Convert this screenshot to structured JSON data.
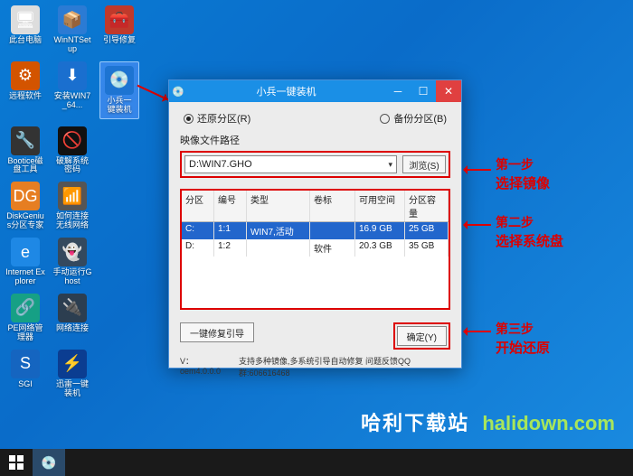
{
  "desktop": {
    "icons": [
      [
        {
          "name": "此台电脑",
          "g": "🖥",
          "bg": "#ddd"
        },
        {
          "name": "WinNTSetup",
          "g": "📦",
          "bg": "#2b7bd4"
        },
        {
          "name": "引导修复",
          "g": "🧰",
          "bg": "#c0392b"
        }
      ],
      [
        {
          "name": "远程软件",
          "g": "⚙",
          "bg": "#d35400"
        },
        {
          "name": "安装WIN7_64...",
          "g": "⬇",
          "bg": "#1a6fcf"
        },
        {
          "name": "小兵一键装机",
          "g": "💿",
          "bg": "#1d74d2",
          "selected": true
        }
      ],
      [
        {
          "name": "Bootice磁盘工具",
          "g": "🔧",
          "bg": "#333"
        },
        {
          "name": "破解系统密码",
          "g": "🚫",
          "bg": "#111"
        }
      ],
      [
        {
          "name": "DiskGenius分区专家",
          "g": "DG",
          "bg": "#e67e22"
        },
        {
          "name": "如何连接无线网络",
          "g": "📶",
          "bg": "#555"
        }
      ],
      [
        {
          "name": "Internet Explorer",
          "g": "e",
          "bg": "#1e88e5"
        },
        {
          "name": "手动运行Ghost",
          "g": "👻",
          "bg": "#34495e"
        }
      ],
      [
        {
          "name": "PE网络管理器",
          "g": "🔗",
          "bg": "#16a085"
        },
        {
          "name": "网络连接",
          "g": "🔌",
          "bg": "#2c3e50"
        }
      ],
      [
        {
          "name": "SGI",
          "g": "S",
          "bg": "#1565c0"
        },
        {
          "name": "迅雷一键装机",
          "g": "⚡",
          "bg": "#0b3d91"
        }
      ]
    ]
  },
  "window": {
    "title": "小兵一键装机",
    "restore_label": "还原分区(R)",
    "backup_label": "备份分区(B)",
    "image_path_label": "映像文件路径",
    "image_path": "D:\\WIN7.GHO",
    "browse": "浏览(S)",
    "headers": {
      "c1": "分区",
      "c2": "编号",
      "c3": "类型",
      "c4": "卷标",
      "c5": "可用空间",
      "c6": "分区容量"
    },
    "rows": [
      {
        "c1": "C:",
        "c2": "1:1",
        "c3": "WIN7,活动",
        "c4": "",
        "c5": "16.9 GB",
        "c6": "25 GB",
        "sel": true
      },
      {
        "c1": "D:",
        "c2": "1:2",
        "c3": "",
        "c4": "软件",
        "c5": "20.3 GB",
        "c6": "35 GB",
        "sel": false
      }
    ],
    "repair": "一键修复引导",
    "ok": "确定(Y)",
    "ver": "V：oem4.0.0.0",
    "support": "支持多种镜像,多系统引导自动修复 问题反馈QQ群:606616468"
  },
  "annots": {
    "s1a": "第一步",
    "s1b": "选择镜像",
    "s2a": "第二步",
    "s2b": "选择系统盘",
    "s3a": "第三步",
    "s3b": "开始还原"
  },
  "watermark": {
    "cn": "哈利下载站",
    "en": "halidown.com"
  }
}
